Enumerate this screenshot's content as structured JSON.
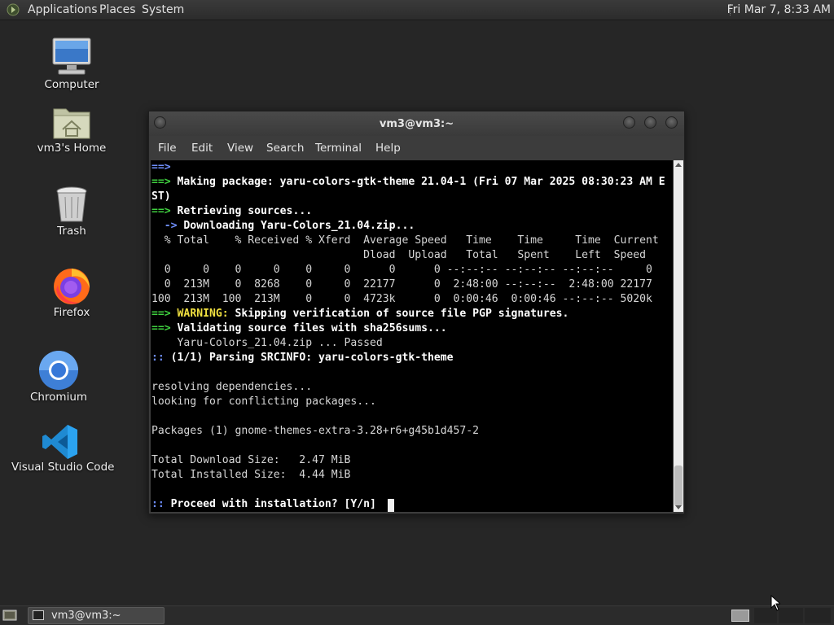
{
  "top_panel": {
    "menus": [
      "Applications",
      "Places",
      "System"
    ],
    "clock": "Fri Mar 7,  8:33 AM"
  },
  "desktop": {
    "icons": [
      {
        "label": "Computer",
        "icon": "computer-icon"
      },
      {
        "label": "vm3's Home",
        "icon": "home-folder-icon"
      },
      {
        "label": "Trash",
        "icon": "trash-icon"
      },
      {
        "label": "Firefox",
        "icon": "firefox-icon"
      },
      {
        "label": "Chromium",
        "icon": "chromium-icon"
      },
      {
        "label": "Visual Studio Code",
        "icon": "vscode-icon"
      }
    ]
  },
  "terminal": {
    "title": "vm3@vm3:~",
    "menu": [
      "File",
      "Edit",
      "View",
      "Search",
      "Terminal",
      "Help"
    ],
    "lines": [
      [
        {
          "t": "==>",
          "c": "bl"
        }
      ],
      [
        {
          "t": "==> ",
          "c": "g"
        },
        {
          "t": "Making package: yaru-colors-gtk-theme 21.04-1 (Fri 07 Mar 2025 08:30:23 AM E",
          "c": "b"
        }
      ],
      [
        {
          "t": "ST)",
          "c": "b"
        }
      ],
      [
        {
          "t": "==> ",
          "c": "g"
        },
        {
          "t": "Retrieving sources...",
          "c": "b"
        }
      ],
      [
        {
          "t": "  -> ",
          "c": "bl"
        },
        {
          "t": "Downloading Yaru-Colors_21.04.zip...",
          "c": "b"
        }
      ],
      [
        {
          "t": "  % Total    % Received % Xferd  Average Speed   Time    Time     Time  Current",
          "c": ""
        }
      ],
      [
        {
          "t": "                                 Dload  Upload   Total   Spent    Left  Speed",
          "c": ""
        }
      ],
      [
        {
          "t": "  0     0    0     0    0     0      0      0 --:--:-- --:--:-- --:--:--     0",
          "c": ""
        }
      ],
      [
        {
          "t": "  0  213M    0  8268    0     0  22177      0  2:48:00 --:--:--  2:48:00 22177",
          "c": ""
        }
      ],
      [
        {
          "t": "100  213M  100  213M    0     0  4723k      0  0:00:46  0:00:46 --:--:-- 5020k",
          "c": ""
        }
      ],
      [
        {
          "t": "==> ",
          "c": "g"
        },
        {
          "t": "WARNING:",
          "c": "y"
        },
        {
          "t": " Skipping verification of source file PGP signatures.",
          "c": "b"
        }
      ],
      [
        {
          "t": "==> ",
          "c": "g"
        },
        {
          "t": "Validating source files with sha256sums...",
          "c": "b"
        }
      ],
      [
        {
          "t": "    Yaru-Colors_21.04.zip ... Passed",
          "c": ""
        }
      ],
      [
        {
          "t": ":: ",
          "c": "bl"
        },
        {
          "t": "(1/1) Parsing SRCINFO: yaru-colors-gtk-theme",
          "c": "b"
        }
      ],
      [
        {
          "t": "",
          "c": ""
        }
      ],
      [
        {
          "t": "resolving dependencies...",
          "c": ""
        }
      ],
      [
        {
          "t": "looking for conflicting packages...",
          "c": ""
        }
      ],
      [
        {
          "t": "",
          "c": ""
        }
      ],
      [
        {
          "t": "Packages (1) gnome-themes-extra-3.28+r6+g45b1d457-2",
          "c": ""
        }
      ],
      [
        {
          "t": "",
          "c": ""
        }
      ],
      [
        {
          "t": "Total Download Size:   2.47 MiB",
          "c": ""
        }
      ],
      [
        {
          "t": "Total Installed Size:  4.44 MiB",
          "c": ""
        }
      ],
      [
        {
          "t": "",
          "c": ""
        }
      ],
      [
        {
          "t": ":: ",
          "c": "bl"
        },
        {
          "t": "Proceed with installation? [Y/n] ",
          "c": "b"
        }
      ]
    ]
  },
  "taskbar": {
    "window_button": "vm3@vm3:~"
  },
  "colors": {
    "desktop_bg": "#262626",
    "terminal_bg": "#000000",
    "prompt_green": "#3fd13f",
    "prompt_blue": "#6f8fff",
    "warning_yellow": "#f0e040"
  }
}
